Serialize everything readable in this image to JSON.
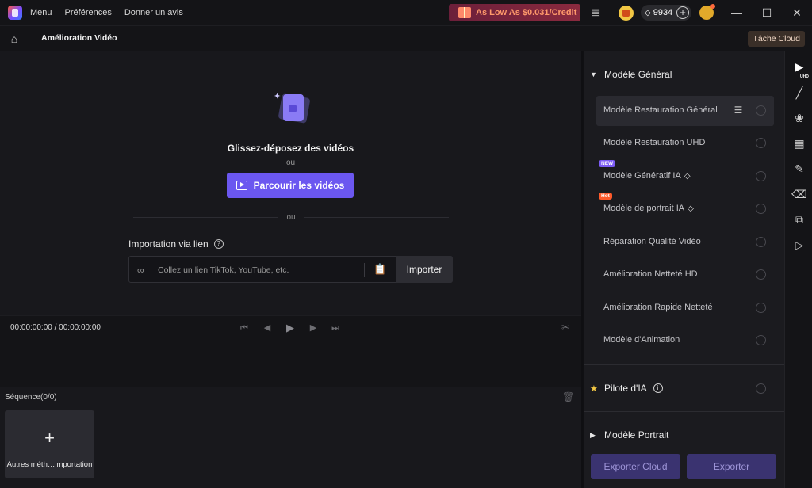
{
  "topbar": {
    "menu_items": [
      "Menu",
      "Préférences",
      "Donner un avis"
    ],
    "promo_text": "As Low As $0.031/Credit",
    "credits": "9934"
  },
  "secbar": {
    "page_title": "Amélioration Vidéo",
    "cloud_task": "Tâche Cloud"
  },
  "main": {
    "drop_title": "Glissez-déposez des vidéos",
    "drop_or": "ou",
    "browse_label": "Parcourir les vidéos",
    "divider_or": "ou",
    "import_label": "Importation via lien",
    "link_placeholder": "Collez un lien TikTok, YouTube, etc.",
    "import_button": "Importer"
  },
  "player": {
    "timecode": "00:00:00:00 / 00:00:00:00"
  },
  "sequence": {
    "label": "Séquence(0/0)",
    "add_label": "Autres méth…importation"
  },
  "models": {
    "general_group": "Modèle Général",
    "general_items": [
      {
        "label": "Modèle Restauration Général",
        "selected": true
      },
      {
        "label": "Modèle Restauration UHD"
      },
      {
        "label": "Modèle Génératif IA",
        "badge": "NEW",
        "premium": true
      },
      {
        "label": "Modèle de portrait IA",
        "badge": "Hot",
        "premium": true
      },
      {
        "label": "Réparation Qualité Vidéo"
      },
      {
        "label": "Amélioration Netteté HD"
      },
      {
        "label": "Amélioration Rapide Netteté"
      },
      {
        "label": "Modèle d'Animation"
      }
    ],
    "ai_pilot": "Pilote d'IA",
    "portrait_group": "Modèle Portrait"
  },
  "export": {
    "cloud": "Exporter Cloud",
    "local": "Exporter"
  },
  "icons": {
    "accent": "#6b57f0",
    "promo_text_color": "#ff9a6b"
  }
}
